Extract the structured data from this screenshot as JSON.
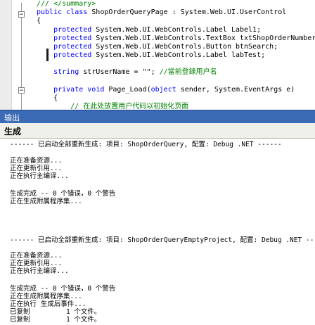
{
  "editor": {
    "lines": [
      "/// </summary>",
      "public class ShopOrderQueryPage : System.Web.UI.UserControl",
      "{",
      "    protected System.Web.UI.WebControls.Label Label1;",
      "    protected System.Web.UI.WebControls.TextBox txtShopOrderNumber;",
      "    protected System.Web.UI.WebControls.Button btnSearch;",
      "    protected System.Web.UI.WebControls.Label labTest;",
      "",
      "    string strUserName = \"\"; //當前登錄用户名",
      "",
      "    private void Page_Load(object sender, System.EventArgs e)",
      "    {",
      "        // 在此处放置用户代码以初始化页面"
    ]
  },
  "output_panel": {
    "title": "输出",
    "source": "生成",
    "lines": [
      "------ 已启动全部重新生成: 项目: ShopOrderQuery, 配置: Debug .NET ------",
      "",
      "正在准备资源...",
      "正在更新引用...",
      "正在执行主编译...",
      "",
      "生成完成 -- 0 个错误，0 个警告",
      "正在生成附属程序集...",
      "",
      "",
      "",
      "",
      "------ 已启动全部重新生成: 项目: ShopOrderQueryEmptyProject, 配置: Debug .NET ------",
      "",
      "正在准备资源...",
      "正在更新引用...",
      "正在执行主编译...",
      "",
      "生成完成 -- 0 个错误，0 个警告",
      "正在生成附属程序集...",
      "正在执行 生成后事件...",
      "已复制         1 个文件。",
      "已复制         1 个文件。"
    ]
  }
}
